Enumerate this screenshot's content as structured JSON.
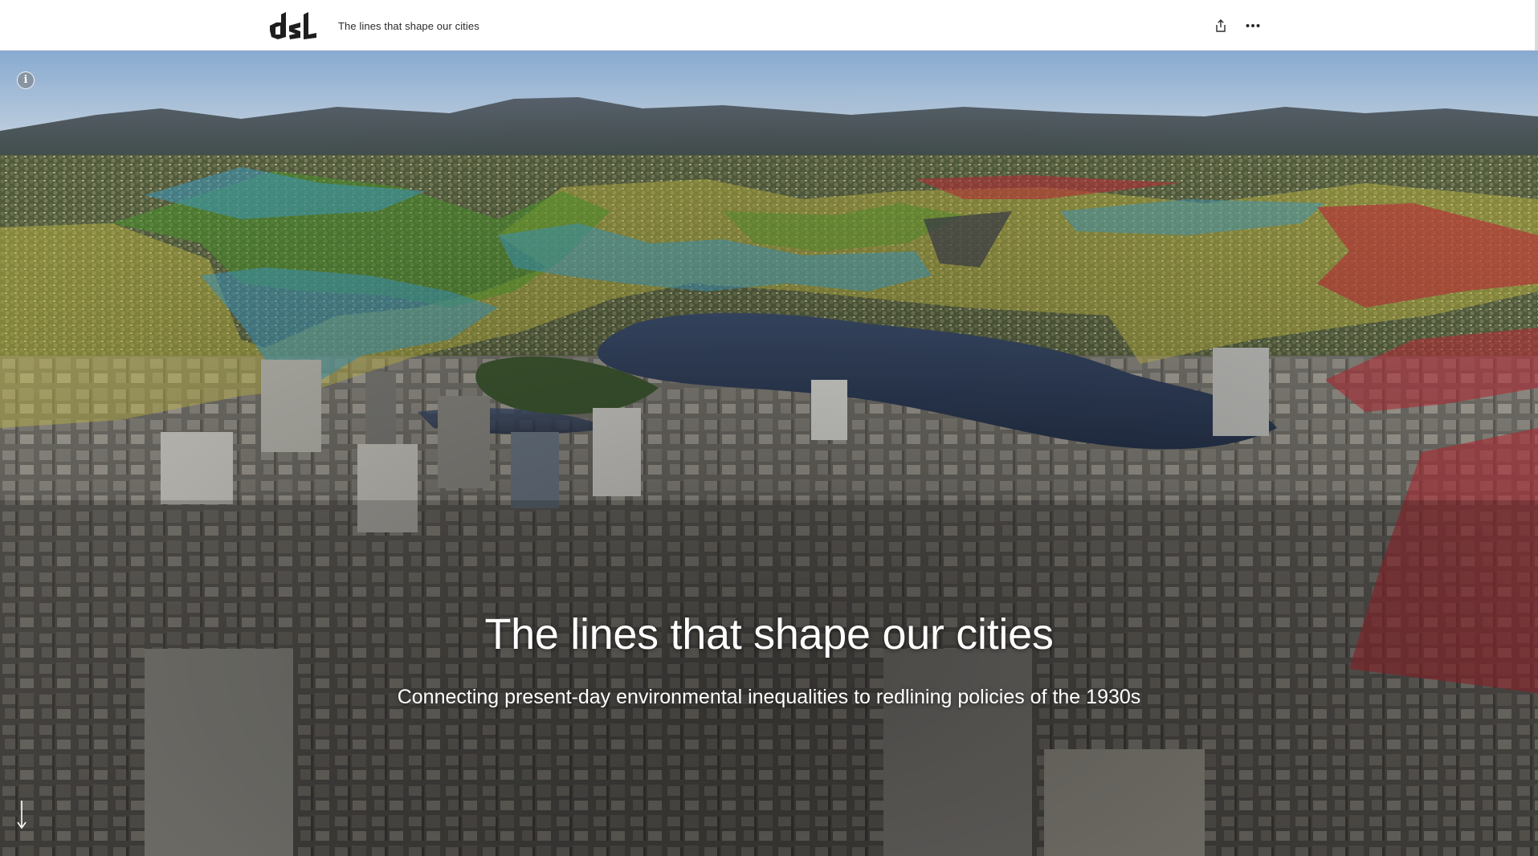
{
  "header": {
    "logo_text": "dsl",
    "title": "The lines that shape our cities",
    "share_icon": "share-icon",
    "more_icon": "more-horizontal-icon"
  },
  "hero": {
    "title": "The lines that shape our cities",
    "subtitle": "Connecting present-day environmental inequalities to redlining policies of the 1930s",
    "info_label": "i",
    "info_icon": "info-icon",
    "scroll_icon": "arrow-down-icon",
    "image_description_colors": {
      "grade_a": "#3fa0c8",
      "grade_b": "#4f9b2e",
      "grade_c": "#d8cf45",
      "grade_d": "#c2313a"
    }
  }
}
